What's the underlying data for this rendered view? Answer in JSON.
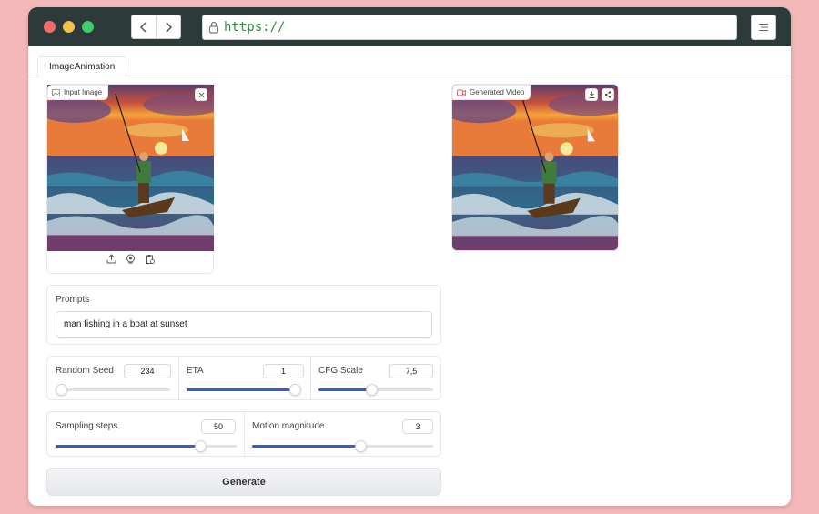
{
  "browser": {
    "url": "https://",
    "back_icon": "chevron-left-icon",
    "forward_icon": "chevron-right-icon",
    "menu_icon": "hamburger-icon"
  },
  "tabs": [
    {
      "label": "ImageAnimation"
    }
  ],
  "input_image": {
    "label": "Input Image"
  },
  "generated_video": {
    "label": "Generated Video"
  },
  "prompts": {
    "label": "Prompts",
    "value": "man fishing in a boat at sunset"
  },
  "controls": {
    "random_seed": {
      "label": "Random Seed",
      "value": "234",
      "level": 0.05
    },
    "eta": {
      "label": "ETA",
      "value": "1",
      "level": 0.98
    },
    "cfg_scale": {
      "label": "CFG Scale",
      "value": "7,5",
      "level": 0.46
    },
    "sampling_steps": {
      "label": "Sampling steps",
      "value": "50",
      "level": 0.8
    },
    "motion_magnitude": {
      "label": "Motion magnitude",
      "value": "3",
      "level": 0.6
    }
  },
  "generate_label": "Generate",
  "colors": {
    "accent": "#2f5fd0",
    "titlebar": "#2c3a3a",
    "background": "#f4b8b8"
  }
}
